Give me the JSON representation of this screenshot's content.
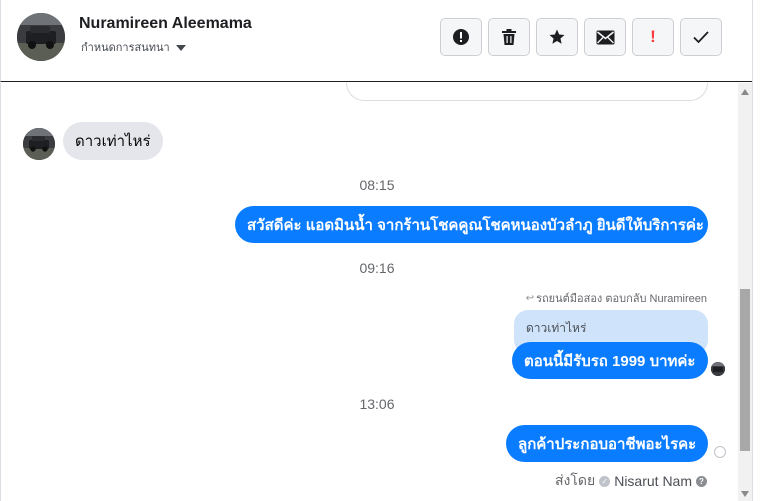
{
  "header": {
    "contact_name": "Nuramireen Aleemama",
    "settings_label": "กำหนดการสนทนา"
  },
  "toolbar": {
    "buttons": [
      {
        "icon": "alert-circle-icon",
        "color": "#1c1e21"
      },
      {
        "icon": "trash-icon",
        "color": "#1c1e21"
      },
      {
        "icon": "star-icon",
        "color": "#1c1e21"
      },
      {
        "icon": "envelope-icon",
        "color": "#1c1e21"
      },
      {
        "label": "!",
        "color": "#fa383e"
      },
      {
        "icon": "checkmark-icon",
        "color": "#1c1e21"
      }
    ]
  },
  "messages": {
    "incoming": {
      "text": "ดาวเท่าไหร่"
    },
    "time_1": "08:15",
    "outgoing_1": {
      "text": "สวัสดีค่ะ แอดมินน้ำ จากร้านโชคคูณโชคหนองบัวลำภู ยินดีให้บริการค่ะ"
    },
    "time_2": "09:16",
    "reply_meta": "รถยนต์มือสอง ตอบกลับ Nuramireen",
    "quoted": "ดาวเท่าไหร่",
    "outgoing_2": {
      "text": "ตอนนี้มีรับรถ 1999 บาทค่ะ"
    },
    "time_3": "13:06",
    "outgoing_3": {
      "text": "ลูกค้าประกอบอาชีพอะไรคะ"
    },
    "sent_by_label": "ส่งโดย",
    "sent_by_agent": "Nisarut Nam"
  },
  "colors": {
    "accent": "#0a7cff",
    "incoming_bubble": "#e4e6eb",
    "quoted_bubble": "#cfe3fb",
    "danger": "#fa383e"
  }
}
